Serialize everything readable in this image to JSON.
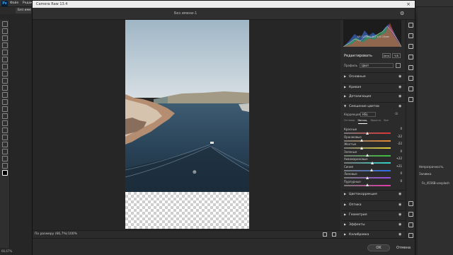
{
  "photoshop": {
    "logo": "Ps",
    "menu": [
      "Файл",
      "Редактиров"
    ],
    "doc_tab": "Без имени-1 @",
    "zoom_status": "66,67%",
    "right_panel": {
      "opacity_label": "Непрозрачность",
      "fill_label": "Заливка",
      "layer_name": "Fo_4556B-unsplash"
    }
  },
  "camera_raw": {
    "app_title": "Camera Raw 13.4",
    "doc_name": "Без имени-1",
    "histogram_info": "f/8   1/200 с   ISO 100   24мм",
    "edit_title": "Редактировать",
    "auto_label": "Авто",
    "bw_label": "Ч/Б",
    "profile_label": "Профиль",
    "profile_value": "Цвет",
    "sections_top": [
      "Основные",
      "Кривая",
      "Детализация"
    ],
    "mix": {
      "title": "Смешение цветов",
      "adjust_label": "Коррекция",
      "adjust_value": "HSL",
      "tabs": [
        "Оттенок",
        "Насыщ.",
        "Яркость",
        "Все"
      ],
      "active_tab": "Насыщ.",
      "sliders": [
        {
          "label": "Красные",
          "value": "0",
          "pos": 0.5,
          "track": "linear-gradient(90deg,#777,#d33)"
        },
        {
          "label": "Оранжевые",
          "value": "-22",
          "pos": 0.39,
          "track": "linear-gradient(90deg,#777,#e8872c)"
        },
        {
          "label": "Желтые",
          "value": "-22",
          "pos": 0.39,
          "track": "linear-gradient(90deg,#777,#e6d030)"
        },
        {
          "label": "Зеленые",
          "value": "0",
          "pos": 0.5,
          "track": "linear-gradient(90deg,#777,#3ac23a)"
        },
        {
          "label": "Аквамариновые",
          "value": "+22",
          "pos": 0.61,
          "track": "linear-gradient(90deg,#777,#2ed3c9)"
        },
        {
          "label": "Синие",
          "value": "+21",
          "pos": 0.6,
          "track": "linear-gradient(90deg,#777,#2c6cf0)"
        },
        {
          "label": "Лиловые",
          "value": "0",
          "pos": 0.5,
          "track": "linear-gradient(90deg,#777,#9a4ce6)"
        },
        {
          "label": "Пурпурные",
          "value": "0",
          "pos": 0.5,
          "track": "linear-gradient(90deg,#777,#e23aa8)"
        }
      ]
    },
    "sections_bottom": [
      "Цветокоррекция",
      "Оптика",
      "Геометрия",
      "Эффекты",
      "Калибровка"
    ],
    "fit_label": "По размеру (66,7%)",
    "zoom_label": "100%",
    "ok_label": "OK",
    "cancel_label": "Отмена"
  }
}
